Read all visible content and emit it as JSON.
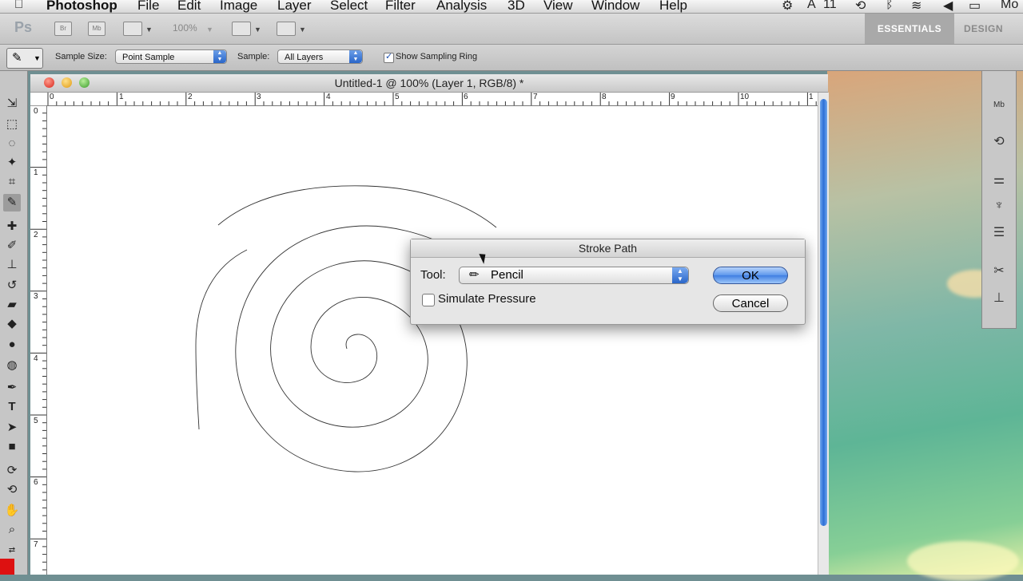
{
  "menubar": {
    "apple_icon": "apple-icon",
    "items": [
      "Photoshop",
      "File",
      "Edit",
      "Image",
      "Layer",
      "Select",
      "Filter",
      "Analysis",
      "3D",
      "View",
      "Window",
      "Help"
    ],
    "status": {
      "adobe_text": "11",
      "clock_partial": "Mo"
    }
  },
  "appbar": {
    "logo": "Ps",
    "bridge_label": "Br",
    "minibridge_label": "Mb",
    "zoom": "100%",
    "workspaces": {
      "active": "ESSENTIALS",
      "other": "DESIGN"
    }
  },
  "options": {
    "sample_size_label": "Sample Size:",
    "sample_size_value": "Point Sample",
    "sample_label": "Sample:",
    "sample_value": "All Layers",
    "show_ring_label": "Show Sampling Ring",
    "show_ring_checked": true
  },
  "document": {
    "title": "Untitled-1 @ 100% (Layer 1, RGB/8) *",
    "h_ruler": [
      "0",
      "1",
      "2",
      "3",
      "4",
      "5",
      "6",
      "7",
      "8",
      "9",
      "10",
      "1"
    ],
    "v_ruler": [
      "0",
      "1",
      "2",
      "3",
      "4",
      "5",
      "6",
      "7"
    ]
  },
  "dialog": {
    "title": "Stroke Path",
    "tool_label": "Tool:",
    "tool_value": "Pencil",
    "simulate_label": "Simulate Pressure",
    "simulate_checked": false,
    "ok_label": "OK",
    "cancel_label": "Cancel"
  },
  "colors": {
    "accent": "#3f7fe2",
    "foreground": "#dd1111"
  }
}
